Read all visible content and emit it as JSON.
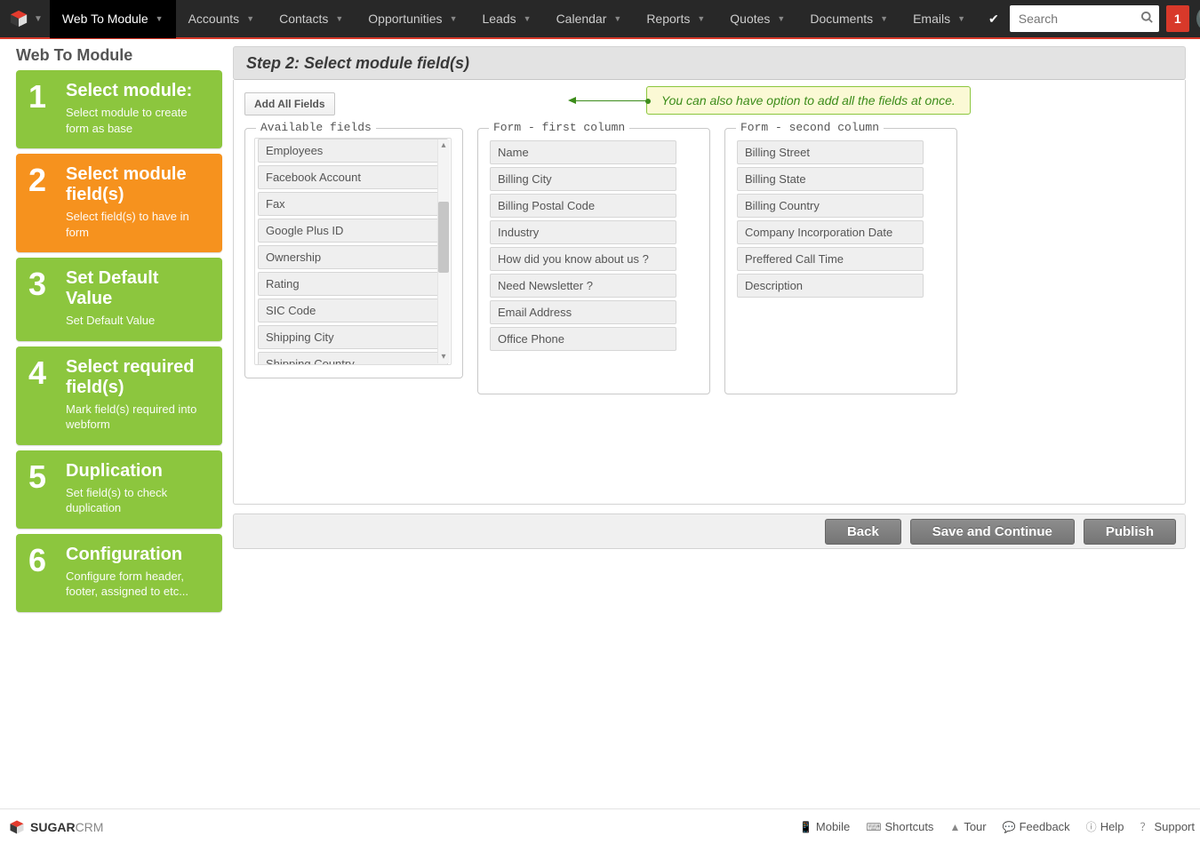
{
  "nav": {
    "active": "Web To Module",
    "items": [
      "Web To Module",
      "Accounts",
      "Contacts",
      "Opportunities",
      "Leads",
      "Calendar",
      "Reports",
      "Quotes",
      "Documents",
      "Emails"
    ],
    "search_placeholder": "Search",
    "notif_count": "1"
  },
  "page_title": "Web To Module",
  "steps": [
    {
      "num": "1",
      "title": "Select module:",
      "desc": "Select module to create form as base",
      "active": false
    },
    {
      "num": "2",
      "title": "Select module field(s)",
      "desc": "Select field(s) to have in form",
      "active": true
    },
    {
      "num": "3",
      "title": "Set Default Value",
      "desc": "Set Default Value",
      "active": false
    },
    {
      "num": "4",
      "title": "Select required field(s)",
      "desc": "Mark field(s) required into webform",
      "active": false
    },
    {
      "num": "5",
      "title": "Duplication",
      "desc": "Set field(s) to check duplication",
      "active": false
    },
    {
      "num": "6",
      "title": "Configuration",
      "desc": "Configure form header, footer, assigned to etc...",
      "active": false
    }
  ],
  "panel": {
    "heading": "Step 2: Select module field(s)",
    "add_all_label": "Add All Fields",
    "tip": "You can also have option to add all the fields at once.",
    "fs_available": "Available fields",
    "fs_col1": "Form - first column",
    "fs_col2": "Form - second column",
    "available": [
      "Employees",
      "Facebook Account",
      "Fax",
      "Google Plus ID",
      "Ownership",
      "Rating",
      "SIC Code",
      "Shipping City",
      "Shipping Country"
    ],
    "col1": [
      "Name",
      "Billing City",
      "Billing Postal Code",
      "Industry",
      "How did you know about us ?",
      "Need Newsletter ?",
      "Email Address",
      "Office Phone"
    ],
    "col2": [
      "Billing Street",
      "Billing State",
      "Billing Country",
      "Company Incorporation Date",
      "Preffered Call Time",
      "Description"
    ]
  },
  "buttons": {
    "back": "Back",
    "save": "Save and Continue",
    "publish": "Publish"
  },
  "footer": {
    "brand_bold": "SUGAR",
    "brand_light": "CRM",
    "links": [
      "Mobile",
      "Shortcuts",
      "Tour",
      "Feedback",
      "Help",
      "Support"
    ]
  }
}
